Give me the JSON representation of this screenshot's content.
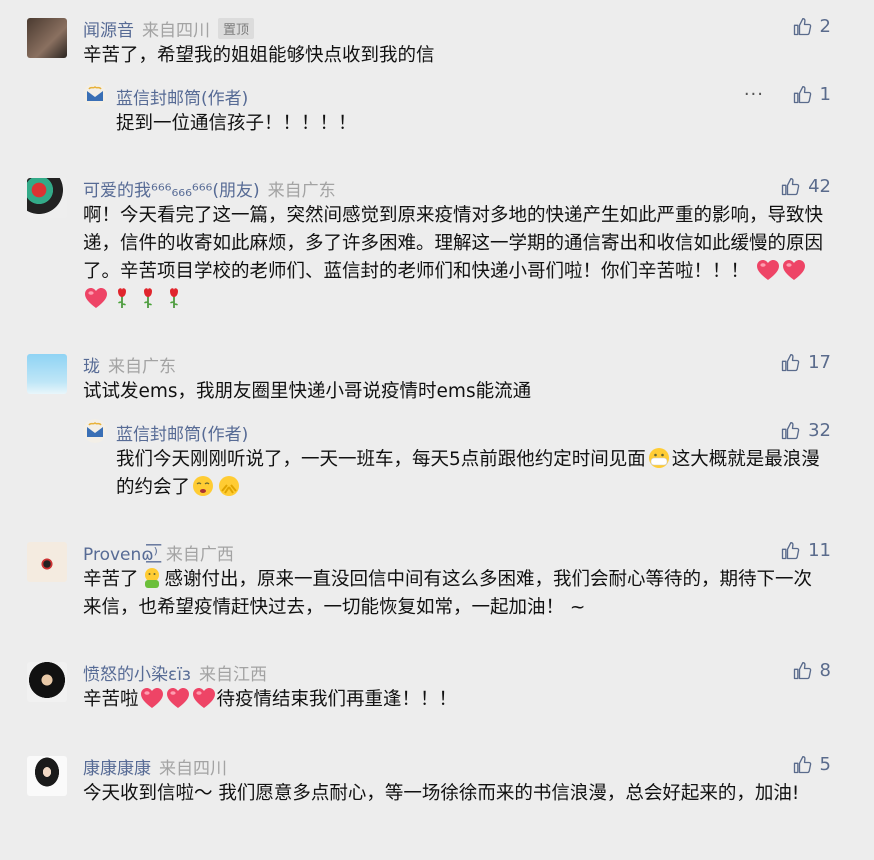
{
  "comments": [
    {
      "name": "闻源音",
      "location": "来自四川",
      "badge": "置顶",
      "likes": "2",
      "text": "辛苦了，希望我的姐姐能够快点收到我的信",
      "reply": {
        "name": "蓝信封邮筒(作者)",
        "likes": "1",
        "more": "···",
        "text": "捉到一位通信孩子！！！！！"
      }
    },
    {
      "name": "可爱的我⁶⁶⁶₆₆₆⁶⁶⁶(朋友)",
      "location": "来自广东",
      "likes": "42",
      "text": "啊！今天看完了这一篇，突然间感觉到原来疫情对多地的快递产生如此严重的影响，导致快递，信件的收寄如此麻烦，多了许多困难。理解这一学期的通信寄出和收信如此缓慢的原因了。辛苦项目学校的老师们、蓝信封的老师们和快递小哥们啦！你们辛苦啦！！！"
    },
    {
      "name": "珑",
      "location": "来自广东",
      "likes": "17",
      "text": "试试发ems，我朋友圈里快递小哥说疫情时ems能流通",
      "reply": {
        "name": "蓝信封邮筒(作者)",
        "likes": "32",
        "text_a": "我们今天刚刚听说了，一天一班车，每天5点前跟他约定时间见面",
        "text_b": "这大概就是最浪漫的约会了"
      }
    },
    {
      "name": "Provenɷ͟͟͞͞⁾",
      "location": "来自广西",
      "likes": "11",
      "text_a": "辛苦了",
      "text_b": "感谢付出，原来一直没回信中间有这么多困难，我们会耐心等待的，期待下一次来信，也希望疫情赶快过去，一切能恢复如常，一起加油！ ~"
    },
    {
      "name": "愤怒的小染ɛïɜ",
      "location": "来自江西",
      "likes": "8",
      "text_a": "辛苦啦",
      "text_b": "待疫情结束我们再重逢！！！"
    },
    {
      "name": "康康康康",
      "location": "来自四川",
      "likes": "5",
      "text": "今天收到信啦～  我们愿意多点耐心，等一场徐徐而来的书信浪漫，总会好起来的，加油!"
    }
  ]
}
